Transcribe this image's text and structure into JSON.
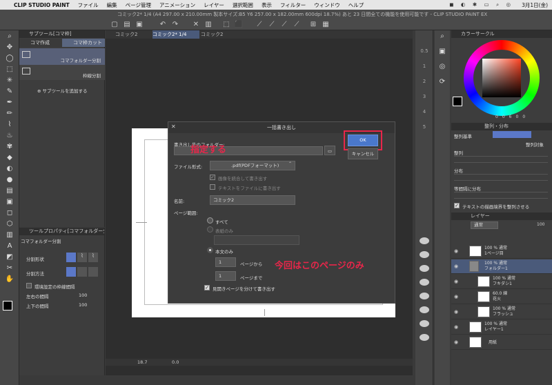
{
  "menubar": {
    "apple": "",
    "app": "CLIP STUDIO PAINT",
    "items": [
      "ファイル",
      "編集",
      "ページ管理",
      "アニメーション",
      "レイヤー",
      "選択範囲",
      "表示",
      "フィルター",
      "ウィンドウ",
      "ヘルプ"
    ],
    "clock": "3月1日(金)"
  },
  "window_title": "コミック2* 1/4 (A4 297.00 x 210.00mm 製本サイズ:B5 Y6 257.00 x 182.00mm 600dpi 18.7%) あと 23 日間全ての機能を使用可能です - CLIP STUDIO PAINT EX",
  "subtool": {
    "title": "サブツール[コマ枠]",
    "tabs": [
      "コマ作成",
      "コマ枠カット"
    ],
    "items": [
      "コマフォルダー分割",
      "枠線分割"
    ],
    "add_label": "サブツールを追加する"
  },
  "toolprop": {
    "title": "ツールプロパティ[コマフォルダー分]",
    "subtitle": "コマフォルダー分割",
    "rows": [
      "分割形状",
      "分割方法"
    ],
    "env_label": "環境設定の枠線間隔",
    "lr_label": "左右の間隔",
    "lr_value": "100",
    "tb_label": "上下の間隔",
    "tb_value": "100"
  },
  "doc_tabs": [
    "コミック2",
    "コミック2* 1/4",
    "コミック2"
  ],
  "canvas_status": {
    "zoom": "18.7",
    "angle": "0.0"
  },
  "dialog": {
    "title": "一括書き出し",
    "folder_label": "書き出し先のフォルダー:",
    "format_label": "ファイル形式:",
    "format_value": ".pdf(PDFフォーマット)",
    "merge_label": "画像を統合して書き出す",
    "text_label": "テキストをファイルに書き出す",
    "name_label": "名前:",
    "name_value": "コミック2",
    "range_label": "ページ範囲:",
    "all_label": "すべて",
    "cover_label": "表紙のみ",
    "body_label": "本文のみ",
    "from_value": "1",
    "from_label": "ページから",
    "to_value": "1",
    "to_label": "ページまで",
    "spread_label": "見開きページを分けて書き出す",
    "ok": "OK",
    "cancel": "キャンセル"
  },
  "annotations": {
    "specify": "指定する",
    "only_page": "今回はこのページのみ",
    "color": "#e8264a"
  },
  "right_nav": [
    "0.5",
    "1",
    "2",
    "3",
    "4",
    "5"
  ],
  "color_wheel": {
    "title": "カラーサークル",
    "values": [
      "0",
      "0",
      "6",
      "0",
      "0"
    ],
    "accent": "#ff4422"
  },
  "align": {
    "title": "整列・分布",
    "basis_label": "整列基準",
    "target_label": "整列対象",
    "align_label": "整列",
    "distribute_label": "分布",
    "spacing_label": "等間隔に分布",
    "checkbox_label": "テキストの描画境界を整列させる"
  },
  "layers": {
    "title": "レイヤー",
    "blend": "通常",
    "opacity": "100",
    "items": [
      {
        "pct": "100 % 通常",
        "name": "1ページ目"
      },
      {
        "pct": "100 % 通常",
        "name": "フォルダー1"
      },
      {
        "pct": "100 % 通常",
        "name": "フキダシ1"
      },
      {
        "pct": "60.0 線",
        "name": "花火"
      },
      {
        "pct": "100 % 通常",
        "name": "フラッシュ"
      },
      {
        "pct": "100 % 通常",
        "name": "レイヤー1"
      },
      {
        "pct": "",
        "name": "用紙"
      }
    ]
  }
}
